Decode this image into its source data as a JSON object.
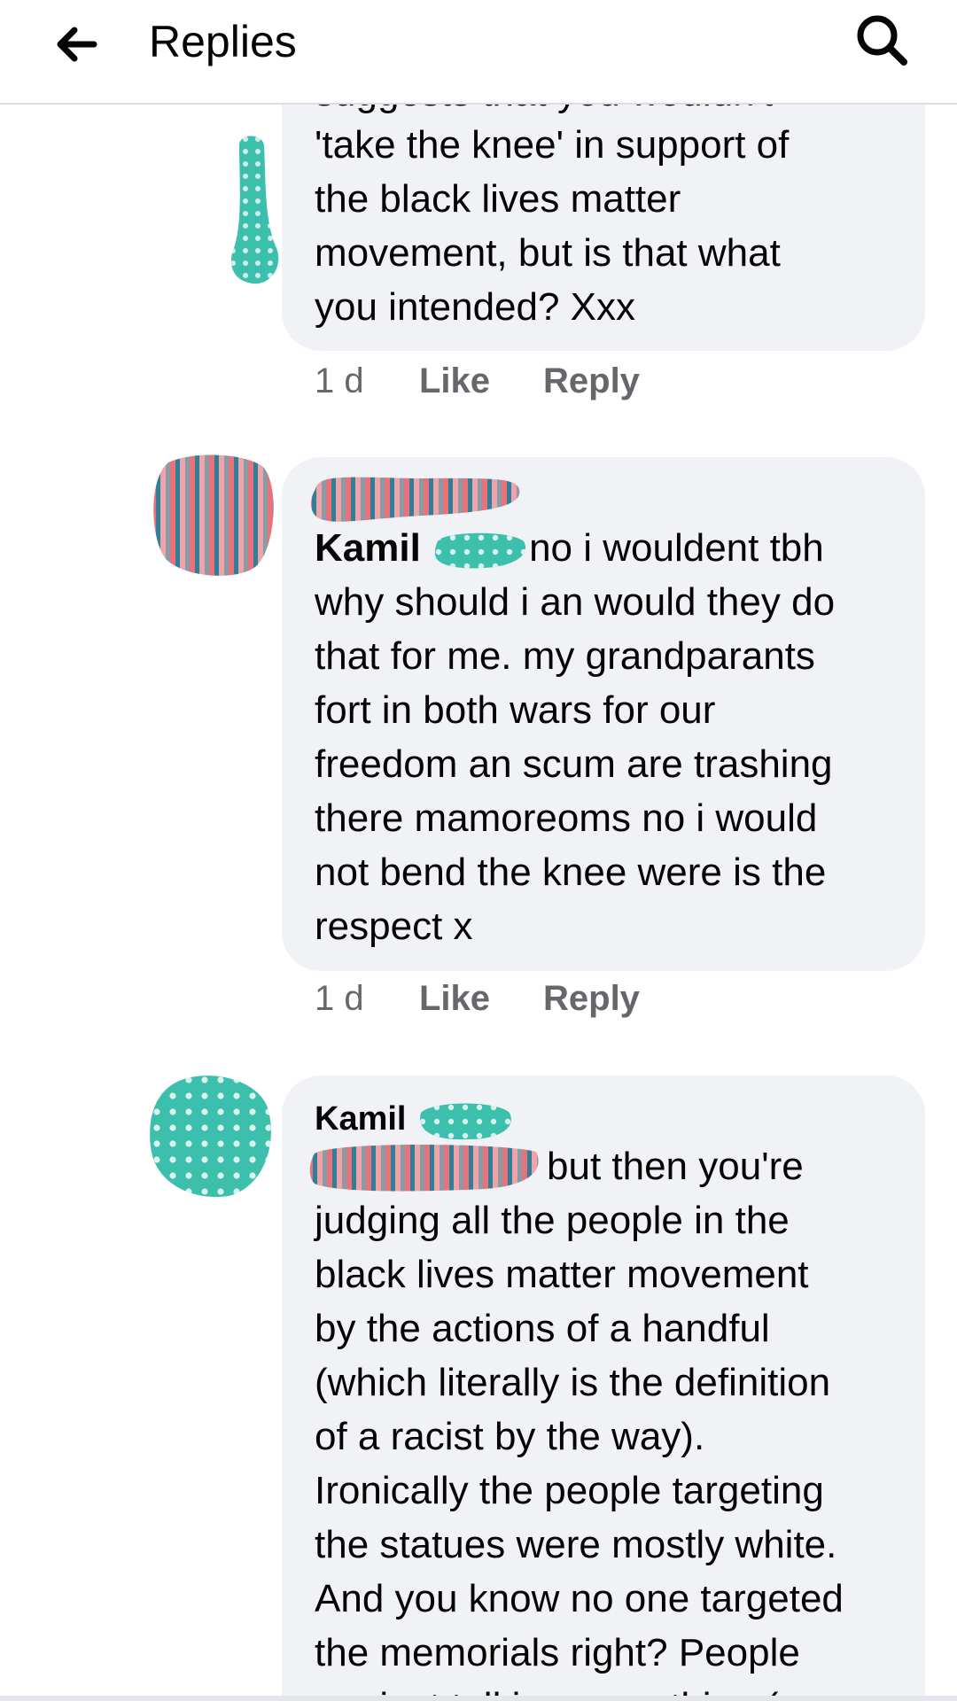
{
  "header": {
    "title": "Replies",
    "back_icon": "arrow-left-icon",
    "search_icon": "search-icon"
  },
  "comments": [
    {
      "partial_top": "suggests that you wouldn't",
      "lines": [
        "'take the knee' in support of",
        "the black lives matter",
        "movement, but is that what",
        "you intended? Xxx"
      ],
      "time": "1 d",
      "like": "Like",
      "reply": "Reply"
    },
    {
      "author": "Kamil",
      "lines_first": "no i wouldent tbh",
      "lines": [
        "why should i an would they do",
        "that for me. my grandparants",
        "fort in both wars for our",
        "freedom an scum are trashing",
        "there mamoreoms no i would",
        "not bend the knee were is the",
        "respect  x"
      ],
      "time": "1 d",
      "like": "Like",
      "reply": "Reply"
    },
    {
      "author": "Kamil",
      "lines_first": "but then you're",
      "lines": [
        "judging all the people in the",
        "black lives matter movement",
        "by the actions of a handful",
        "(which literally is the definition",
        "of a racist by the way).",
        "Ironically the people targeting",
        "the statues were mostly white.",
        "And you know no one targeted",
        "the memorials right? People"
      ],
      "partial_bottom": "against talking something (eg"
    }
  ],
  "colors": {
    "teal": "#3dbfae",
    "bubble": "#f0f2f5",
    "meta": "#65676b"
  }
}
